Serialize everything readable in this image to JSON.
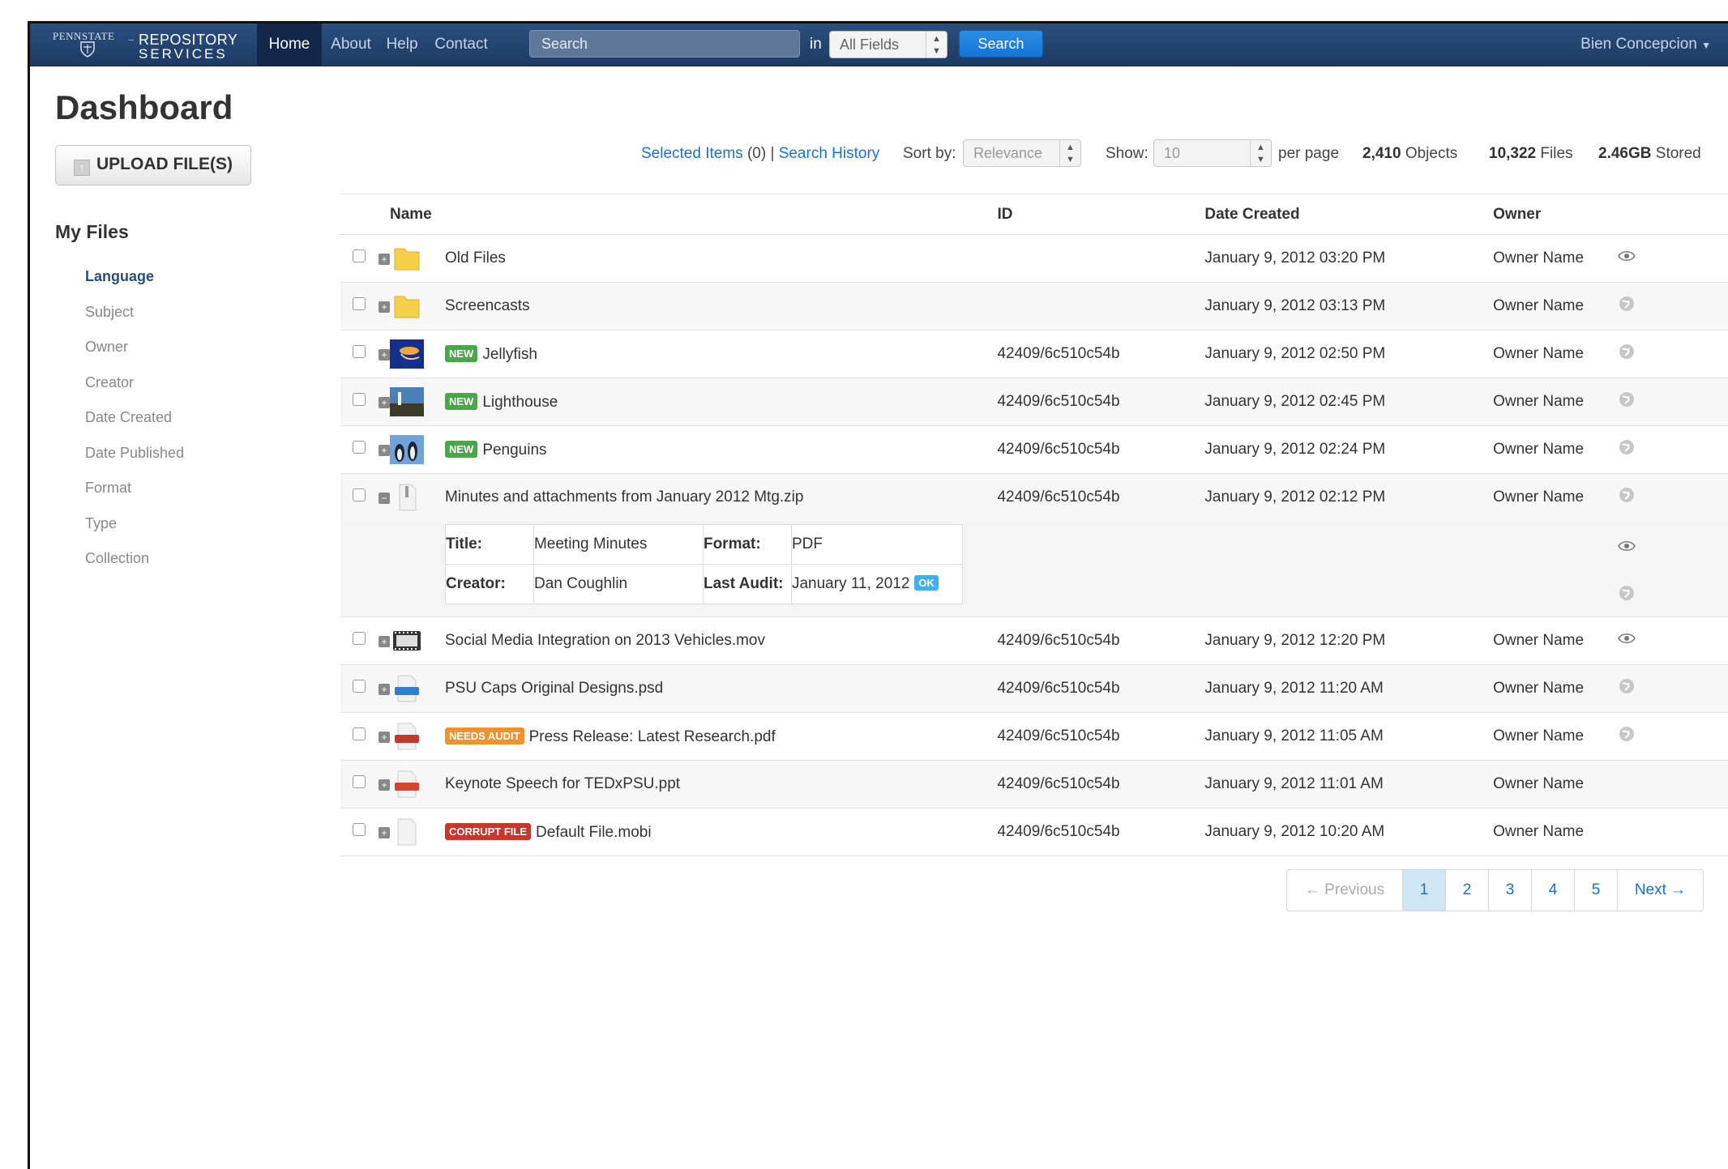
{
  "brand": {
    "psu": "PENNSTATE",
    "line1": "REPOSITORY",
    "line2": "SERVICES"
  },
  "nav": {
    "items": [
      "Home",
      "About",
      "Help",
      "Contact"
    ],
    "active": "Home"
  },
  "search": {
    "placeholder": "Search",
    "in_label": "in",
    "field_select": "All Fields",
    "button": "Search"
  },
  "user": {
    "name": "Bien Concepcion"
  },
  "page": {
    "title": "Dashboard",
    "upload_label": "UPLOAD FILE(S)"
  },
  "sidebar": {
    "title": "My Files",
    "facets": [
      "Language",
      "Subject",
      "Owner",
      "Creator",
      "Date Created",
      "Date Published",
      "Format",
      "Type",
      "Collection"
    ],
    "active": "Language"
  },
  "toolbar": {
    "selected_items": "Selected Items",
    "selected_count": "(0)",
    "separator": "|",
    "search_history": "Search History",
    "sort_label": "Sort by:",
    "sort_value": "Relevance",
    "show_label": "Show:",
    "show_value": "10",
    "per_page": "per page",
    "objects_count": "2,410",
    "objects_label": "Objects",
    "files_count": "10,322",
    "files_label": "Files",
    "stored_amount": "2.46GB",
    "stored_label": "Stored"
  },
  "table": {
    "headers": {
      "name": "Name",
      "id": "ID",
      "date": "Date Created",
      "owner": "Owner"
    },
    "rows": [
      {
        "name": "Old Files",
        "id": "",
        "date": "January 9, 2012 03:20 PM",
        "owner": "Owner Name",
        "icon": "folder-icon",
        "badge": "",
        "action": "eye-icon"
      },
      {
        "name": "Screencasts",
        "id": "",
        "date": "January 9, 2012 03:13 PM",
        "owner": "Owner Name",
        "icon": "folder-icon",
        "badge": "",
        "action": "globe-icon"
      },
      {
        "name": "Jellyfish",
        "id": "42409/6c510c54b",
        "date": "January 9, 2012 02:50 PM",
        "owner": "Owner Name",
        "icon": "jellyfish-thumbnail",
        "badge": "NEW",
        "action": "globe-icon"
      },
      {
        "name": "Lighthouse",
        "id": "42409/6c510c54b",
        "date": "January 9, 2012 02:45 PM",
        "owner": "Owner Name",
        "icon": "lighthouse-thumbnail",
        "badge": "NEW",
        "action": "globe-icon"
      },
      {
        "name": "Penguins",
        "id": "42409/6c510c54b",
        "date": "January 9, 2012 02:24 PM",
        "owner": "Owner Name",
        "icon": "penguins-thumbnail",
        "badge": "NEW",
        "action": "globe-icon"
      },
      {
        "name": "Minutes and attachments from January 2012 Mtg.zip",
        "id": "42409/6c510c54b",
        "date": "January 9, 2012 02:12 PM",
        "owner": "Owner Name",
        "icon": "zip-icon",
        "badge": "",
        "action": "globe-icon"
      },
      {
        "name": "Social Media Integration on 2013 Vehicles.mov",
        "id": "42409/6c510c54b",
        "date": "January 9, 2012 12:20 PM",
        "owner": "Owner Name",
        "icon": "film-icon",
        "badge": "",
        "action": "eye-icon"
      },
      {
        "name": "PSU Caps Original Designs.psd",
        "id": "42409/6c510c54b",
        "date": "January 9, 2012 11:20 AM",
        "owner": "Owner Name",
        "icon": "psd-file-icon",
        "badge": "",
        "action": "globe-icon"
      },
      {
        "name": "Press Release: Latest Research.pdf",
        "id": "42409/6c510c54b",
        "date": "January 9, 2012 11:05 AM",
        "owner": "Owner Name",
        "icon": "pdf-file-icon",
        "badge": "NEEDS AUDIT",
        "action": "globe-icon"
      },
      {
        "name": "Keynote Speech for TEDxPSU.ppt",
        "id": "42409/6c510c54b",
        "date": "January 9, 2012 11:01 AM",
        "owner": "Owner Name",
        "icon": "ppt-file-icon",
        "badge": "",
        "action": ""
      },
      {
        "name": "Default File.mobi",
        "id": "42409/6c510c54b",
        "date": "January 9, 2012 10:20 AM",
        "owner": "Owner Name",
        "icon": "blank-file-icon",
        "badge": "CORRUPT FILE",
        "action": ""
      }
    ],
    "detail": {
      "title_label": "Title:",
      "title_value": "Meeting Minutes",
      "format_label": "Format:",
      "format_value": "PDF",
      "creator_label": "Creator:",
      "creator_value": "Dan Coughlin",
      "audit_label": "Last Audit:",
      "audit_value": "January 11, 2012",
      "audit_status": "OK"
    }
  },
  "pagination": {
    "prev": "← Previous",
    "pages": [
      "1",
      "2",
      "3",
      "4",
      "5"
    ],
    "next": "Next →",
    "current": "1"
  },
  "colors": {
    "navbar": "#1d3a63",
    "link": "#1a73c9",
    "new_badge": "#4aa64a",
    "audit_badge": "#f0932f",
    "corrupt_badge": "#c9372c",
    "ok_badge": "#3fb0e8"
  }
}
